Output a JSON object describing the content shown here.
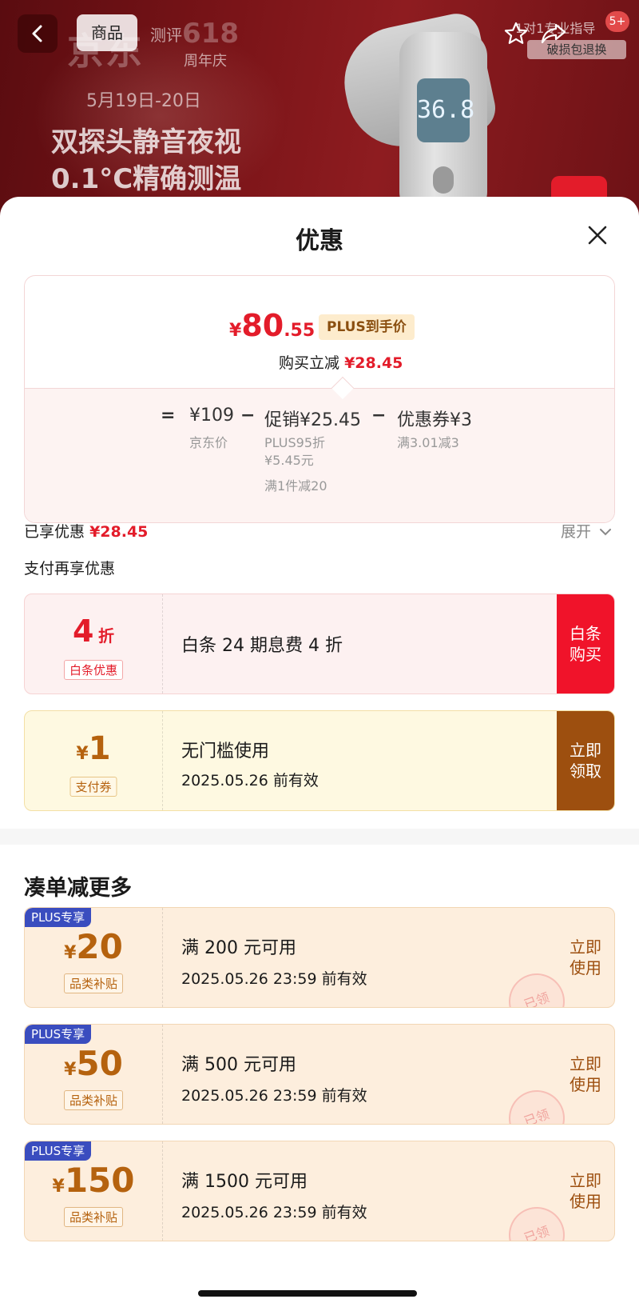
{
  "banner": {
    "tab_product": "商品",
    "tab_review": "测评",
    "brand": "京东",
    "brand_number": "618",
    "anniversary": "周年庆",
    "date": "5月19日-20日",
    "headline_1": "双探头静音夜视",
    "headline_2": "0.1°C精确测温",
    "display_reading": "36.8",
    "promo_line_1": "1对1专业指导",
    "promo_line_2": "破损包退换",
    "badge_count": "5+"
  },
  "sheet": {
    "title": "优惠"
  },
  "price": {
    "currency": "¥",
    "integer": "80",
    "decimal": ".55",
    "tag": "PLUS到手价",
    "save_label": "购买立减",
    "save_amount": "¥28.45",
    "equation": {
      "equals": "=",
      "base": "¥109",
      "minus_1": "−",
      "promo": "促销¥25.45",
      "minus_2": "−",
      "coupon": "优惠券¥3",
      "base_label": "京东价",
      "promo_detail": "PLUS95折 ¥5.45元",
      "promo_detail_2": "满1件减20",
      "coupon_detail": "满3.01减3"
    }
  },
  "enjoyed": {
    "label": "已享优惠",
    "amount": "¥28.45",
    "expand": "展开"
  },
  "pay_more_title": "支付再享优惠",
  "coupons": {
    "baitiao": {
      "value": "4",
      "unit": "折",
      "label": "白条优惠",
      "desc": "白条 24 期息费 4 折",
      "action": "白条购买"
    },
    "pay": {
      "currency": "¥",
      "value": "1",
      "label": "支付券",
      "desc": "无门槛使用",
      "expire": "2025.05.26 前有效",
      "action": "立即领取"
    }
  },
  "more_title": "凑单减更多",
  "plus_coupons": [
    {
      "badge": "PLUS专享",
      "currency": "¥",
      "value": "20",
      "label": "品类补贴",
      "desc": "满 200 元可用",
      "expire": "2025.05.26 23:59 前有效",
      "action": "立即使用",
      "stamp": "已领"
    },
    {
      "badge": "PLUS专享",
      "currency": "¥",
      "value": "50",
      "label": "品类补贴",
      "desc": "满 500 元可用",
      "expire": "2025.05.26 23:59 前有效",
      "action": "立即使用",
      "stamp": "已领"
    },
    {
      "badge": "PLUS专享",
      "currency": "¥",
      "value": "150",
      "label": "品类补贴",
      "desc": "满 1500 元可用",
      "expire": "2025.05.26 23:59 前有效",
      "action": "立即使用",
      "stamp": "已领"
    }
  ],
  "colors": {
    "accent_red": "#e31c2a",
    "gold_brown": "#9d4f0f",
    "plus_blue": "#3a4dbf"
  },
  "icons": [
    "back-icon",
    "star-icon",
    "share-icon",
    "close-icon",
    "chevron-down-icon"
  ]
}
